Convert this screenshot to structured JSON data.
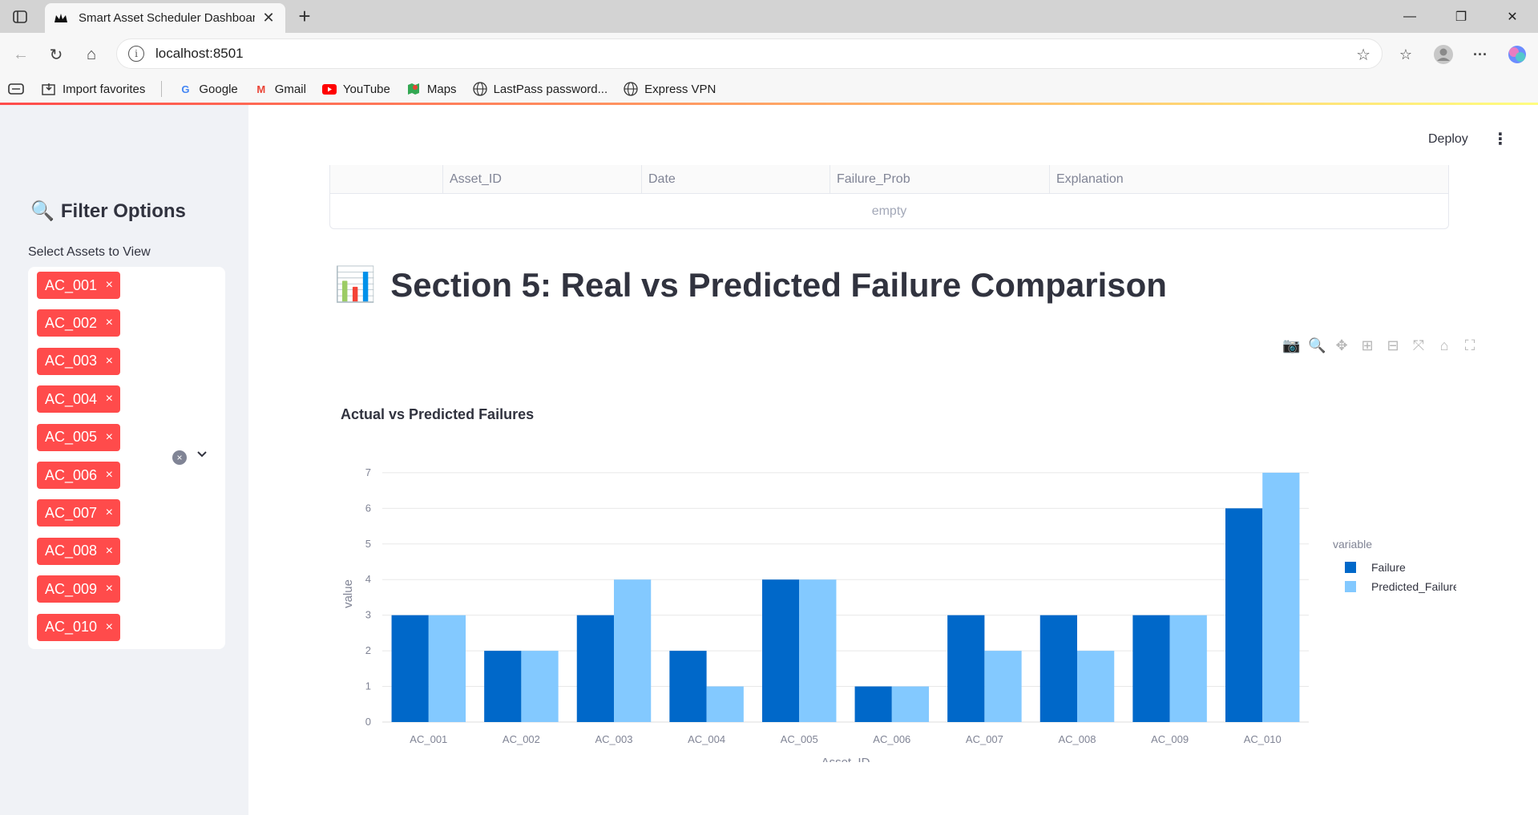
{
  "browser": {
    "tab_title": "Smart Asset Scheduler Dashboard",
    "tab_close": "✕",
    "new_tab": "+",
    "url": "localhost:8501",
    "bookmarks": [
      {
        "label": "Import favorites",
        "icon": "import-icon"
      },
      {
        "label": "Google",
        "icon": "google-icon"
      },
      {
        "label": "Gmail",
        "icon": "gmail-icon"
      },
      {
        "label": "YouTube",
        "icon": "youtube-icon"
      },
      {
        "label": "Maps",
        "icon": "maps-icon"
      },
      {
        "label": "LastPass password...",
        "icon": "globe-icon"
      },
      {
        "label": "Express VPN",
        "icon": "globe-icon"
      }
    ]
  },
  "sidebar": {
    "title": "Filter Options",
    "title_icon": "🔍",
    "select_label": "Select Assets to View",
    "selected_assets": [
      "AC_001",
      "AC_002",
      "AC_003",
      "AC_004",
      "AC_005",
      "AC_006",
      "AC_007",
      "AC_008",
      "AC_009",
      "AC_010"
    ],
    "chip_remove": "×",
    "clear_glyph": "×",
    "caret_glyph": "⌄"
  },
  "header": {
    "deploy_label": "Deploy",
    "menu_glyph": "⋮"
  },
  "dataframe": {
    "columns": [
      "Asset_ID",
      "Date",
      "Failure_Prob",
      "Explanation"
    ],
    "empty_text": "empty"
  },
  "section": {
    "icon": "📊",
    "title": "Section 5: Real vs Predicted Failure Comparison"
  },
  "colors": {
    "accent": "#ff4b4b",
    "failure": "#0068c9",
    "predicted": "#83c9ff"
  },
  "chart_data": {
    "type": "bar",
    "title": "Actual vs Predicted Failures",
    "xlabel": "Asset_ID",
    "ylabel": "value",
    "legend_title": "variable",
    "legend_position": "top-right",
    "categories": [
      "AC_001",
      "AC_002",
      "AC_003",
      "AC_004",
      "AC_005",
      "AC_006",
      "AC_007",
      "AC_008",
      "AC_009",
      "AC_010"
    ],
    "series": [
      {
        "name": "Failure",
        "values": [
          3,
          2,
          3,
          2,
          4,
          1,
          3,
          3,
          3,
          6
        ]
      },
      {
        "name": "Predicted_Failure",
        "values": [
          3,
          2,
          4,
          1,
          4,
          1,
          2,
          2,
          3,
          7
        ]
      }
    ],
    "yticks": [
      0,
      1,
      2,
      3,
      4,
      5,
      6,
      7
    ],
    "ylim": [
      0,
      7.2
    ],
    "grid": true
  }
}
